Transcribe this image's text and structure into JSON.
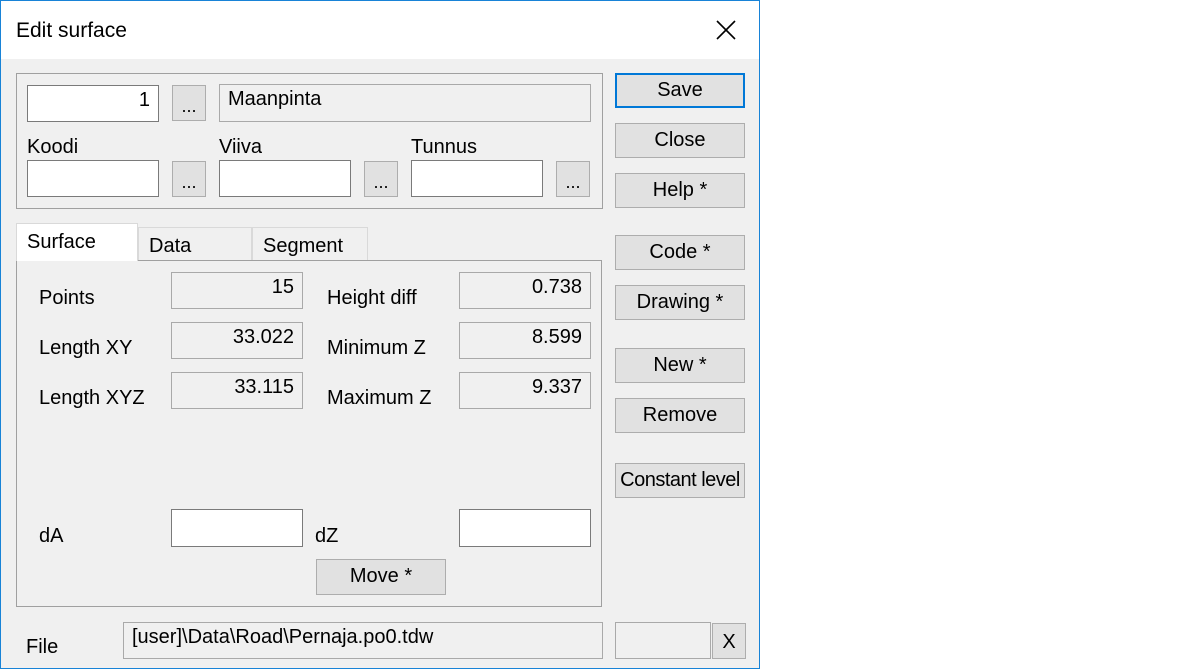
{
  "window": {
    "title": "Edit surface"
  },
  "header": {
    "number_value": "1",
    "name_value": "Maanpinta",
    "browse_label": "...",
    "koodi_label": "Koodi",
    "viiva_label": "Viiva",
    "tunnus_label": "Tunnus",
    "koodi_value": "",
    "viiva_value": "",
    "tunnus_value": ""
  },
  "tabs": [
    {
      "label": "Surface",
      "active": true
    },
    {
      "label": "Data",
      "active": false
    },
    {
      "label": "Segment",
      "active": false
    }
  ],
  "surface": {
    "points_label": "Points",
    "points_value": "15",
    "length_xy_label": "Length XY",
    "length_xy_value": "33.022",
    "length_xyz_label": "Length XYZ",
    "length_xyz_value": "33.115",
    "height_diff_label": "Height diff",
    "height_diff_value": "0.738",
    "min_z_label": "Minimum Z",
    "min_z_value": "8.599",
    "max_z_label": "Maximum Z",
    "max_z_value": "9.337",
    "da_label": "dA",
    "da_value": "",
    "dz_label": "dZ",
    "dz_value": "",
    "move_label": "Move *"
  },
  "side_buttons": {
    "save": "Save",
    "close": "Close",
    "help": "Help *",
    "code": "Code *",
    "drawing": "Drawing *",
    "new": "New *",
    "remove": "Remove",
    "constant_level": "Constant level"
  },
  "footer": {
    "file_label": "File",
    "file_value": "[user]\\Data\\Road\\Pernaja.po0.tdw",
    "extra_value": "",
    "clear_label": "X"
  },
  "colors": {
    "accent": "#0078d7",
    "window_border": "#1883d7",
    "dialog_bg": "#f0f0f0"
  }
}
